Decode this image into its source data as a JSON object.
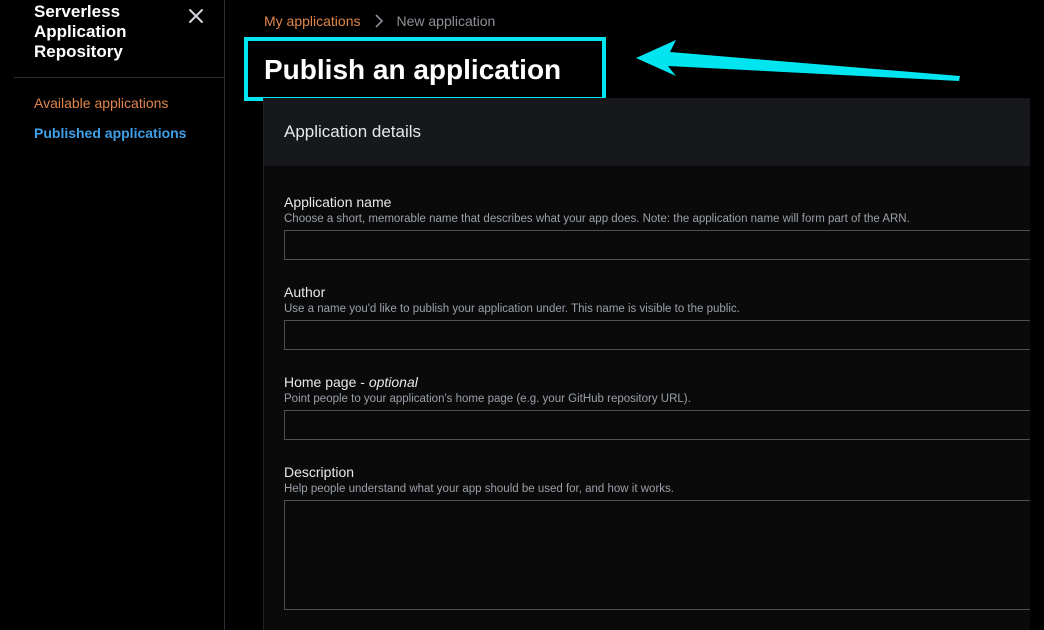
{
  "sidebar": {
    "title": "Serverless Application Repository",
    "close_icon": "close-icon",
    "items": [
      {
        "label": "Available applications",
        "color": "#e0854a"
      },
      {
        "label": "Published applications",
        "color": "#3fa0e8",
        "active": true
      }
    ]
  },
  "breadcrumb": {
    "link": "My applications",
    "separator_icon": "chevron-right-icon",
    "current": "New application"
  },
  "page": {
    "title": "Publish an application"
  },
  "annotation": {
    "highlight_color": "#00e5ef"
  },
  "panel": {
    "title": "Application details",
    "fields": {
      "name": {
        "label": "Application name",
        "description": "Choose a short, memorable name that describes what your app does. Note: the application name will form part of the ARN.",
        "value": ""
      },
      "author": {
        "label": "Author",
        "description": "Use a name you'd like to publish your application under. This name is visible to the public.",
        "value": ""
      },
      "home_page": {
        "label": "Home page - ",
        "optional": "optional",
        "description": "Point people to your application's home page (e.g. your GitHub repository URL).",
        "value": ""
      },
      "description": {
        "label": "Description",
        "description": "Help people understand what your app should be used for, and how it works.",
        "value": ""
      }
    }
  }
}
